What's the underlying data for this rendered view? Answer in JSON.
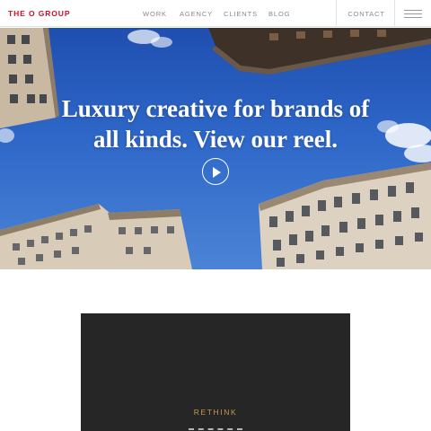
{
  "header": {
    "logo": "THE O GROUP",
    "nav": [
      "WORK",
      "AGENCY",
      "CLIENTS",
      "BLOG"
    ],
    "contact": "CONTACT",
    "menu_icon": "hamburger-menu-icon"
  },
  "hero": {
    "headline_line1": "Luxury creative for brands of",
    "headline_line2": "all kinds. View our reel.",
    "play_icon": "play-icon"
  },
  "section": {
    "eyebrow": "RETHINK"
  },
  "colors": {
    "brand_red": "#c8102e",
    "nav_gray": "#8a8a8a",
    "sky_blue": "#2e67c8",
    "card_dark": "#262626",
    "eyebrow_gold": "#c79a4f"
  }
}
